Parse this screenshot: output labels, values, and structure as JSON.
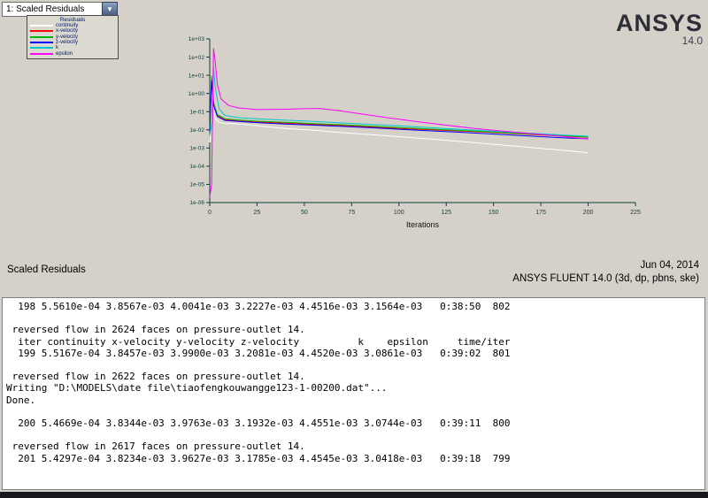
{
  "combo": {
    "value": "1: Scaled Residuals"
  },
  "legend": {
    "title": "Residuals",
    "items": [
      {
        "label": "continuity",
        "color": "#ffffff"
      },
      {
        "label": "x-velocity",
        "color": "#ff0000"
      },
      {
        "label": "y-velocity",
        "color": "#00b400"
      },
      {
        "label": "z-velocity",
        "color": "#0000ff"
      },
      {
        "label": "k",
        "color": "#00c8c8"
      },
      {
        "label": "epsilon",
        "color": "#ff00ff"
      }
    ]
  },
  "logo": {
    "brand": "ANSYS",
    "version": "14.0"
  },
  "caption": {
    "left": "Scaled Residuals",
    "date": "Jun 04, 2014",
    "app": "ANSYS FLUENT 14.0 (3d, dp, pbns, ske)"
  },
  "chart_data": {
    "type": "line",
    "title": "Scaled Residuals",
    "xlabel": "Iterations",
    "x_scale": "linear",
    "y_scale": "log",
    "xlim": [
      0,
      225
    ],
    "ylim_log": [
      -6,
      3
    ],
    "x_ticks": [
      0,
      25,
      50,
      75,
      100,
      125,
      150,
      175,
      200,
      225
    ],
    "y_tick_labels": [
      "1e+03",
      "1e+02",
      "1e+01",
      "1e+00",
      "1e-01",
      "1e-02",
      "1e-03",
      "1e-04",
      "1e-05",
      "1e-06"
    ],
    "axis_color": "#143c3c",
    "grid": false,
    "legend_position": "top-left",
    "series": [
      {
        "name": "continuity",
        "color": "#ffffff",
        "points": [
          [
            0,
            0.002
          ],
          [
            1,
            0.9
          ],
          [
            2,
            0.12
          ],
          [
            3,
            0.04
          ],
          [
            5,
            0.026
          ],
          [
            8,
            0.022
          ],
          [
            12,
            0.022
          ],
          [
            20,
            0.019
          ],
          [
            30,
            0.015
          ],
          [
            40,
            0.012
          ],
          [
            55,
            0.0095
          ],
          [
            70,
            0.007
          ],
          [
            85,
            0.0055
          ],
          [
            100,
            0.0042
          ],
          [
            115,
            0.0032
          ],
          [
            130,
            0.0024
          ],
          [
            145,
            0.0018
          ],
          [
            160,
            0.0013
          ],
          [
            175,
            0.00095
          ],
          [
            190,
            0.0007
          ],
          [
            200,
            0.00055
          ]
        ]
      },
      {
        "name": "x-velocity",
        "color": "#ff0000",
        "points": [
          [
            0,
            0.01
          ],
          [
            1,
            6
          ],
          [
            2,
            0.25
          ],
          [
            4,
            0.06
          ],
          [
            8,
            0.036
          ],
          [
            15,
            0.031
          ],
          [
            25,
            0.027
          ],
          [
            40,
            0.023
          ],
          [
            55,
            0.02
          ],
          [
            70,
            0.017
          ],
          [
            85,
            0.0145
          ],
          [
            100,
            0.012
          ],
          [
            115,
            0.0103
          ],
          [
            130,
            0.0088
          ],
          [
            145,
            0.0075
          ],
          [
            160,
            0.0063
          ],
          [
            175,
            0.0052
          ],
          [
            190,
            0.0044
          ],
          [
            200,
            0.0039
          ]
        ]
      },
      {
        "name": "y-velocity",
        "color": "#00b400",
        "points": [
          [
            0,
            0.012
          ],
          [
            1,
            9
          ],
          [
            2,
            0.32
          ],
          [
            4,
            0.07
          ],
          [
            8,
            0.041
          ],
          [
            15,
            0.035
          ],
          [
            25,
            0.03
          ],
          [
            40,
            0.026
          ],
          [
            55,
            0.022
          ],
          [
            70,
            0.019
          ],
          [
            85,
            0.016
          ],
          [
            100,
            0.0133
          ],
          [
            115,
            0.0112
          ],
          [
            130,
            0.0095
          ],
          [
            145,
            0.008
          ],
          [
            160,
            0.0066
          ],
          [
            175,
            0.0055
          ],
          [
            190,
            0.0046
          ],
          [
            200,
            0.004
          ]
        ]
      },
      {
        "name": "z-velocity",
        "color": "#0000ff",
        "points": [
          [
            0,
            0.008
          ],
          [
            1,
            5
          ],
          [
            2,
            0.22
          ],
          [
            4,
            0.055
          ],
          [
            8,
            0.033
          ],
          [
            15,
            0.029
          ],
          [
            25,
            0.025
          ],
          [
            40,
            0.021
          ],
          [
            55,
            0.018
          ],
          [
            70,
            0.0155
          ],
          [
            85,
            0.013
          ],
          [
            100,
            0.0108
          ],
          [
            115,
            0.009
          ],
          [
            130,
            0.0075
          ],
          [
            145,
            0.0062
          ],
          [
            160,
            0.0051
          ],
          [
            175,
            0.0042
          ],
          [
            190,
            0.0035
          ],
          [
            200,
            0.0032
          ]
        ]
      },
      {
        "name": "k",
        "color": "#00c8c8",
        "points": [
          [
            0,
            0.005
          ],
          [
            1,
            0.02
          ],
          [
            2,
            28
          ],
          [
            3,
            1.8
          ],
          [
            5,
            0.14
          ],
          [
            8,
            0.062
          ],
          [
            15,
            0.047
          ],
          [
            25,
            0.04
          ],
          [
            40,
            0.034
          ],
          [
            55,
            0.029
          ],
          [
            70,
            0.024
          ],
          [
            85,
            0.02
          ],
          [
            100,
            0.0165
          ],
          [
            115,
            0.0135
          ],
          [
            130,
            0.011
          ],
          [
            145,
            0.009
          ],
          [
            160,
            0.0074
          ],
          [
            175,
            0.006
          ],
          [
            190,
            0.005
          ],
          [
            200,
            0.0045
          ]
        ]
      },
      {
        "name": "epsilon",
        "color": "#ff00ff",
        "points": [
          [
            0,
            2e-06
          ],
          [
            1,
            1e-05
          ],
          [
            2,
            300
          ],
          [
            3,
            45
          ],
          [
            4,
            3
          ],
          [
            6,
            0.5
          ],
          [
            10,
            0.22
          ],
          [
            15,
            0.16
          ],
          [
            25,
            0.13
          ],
          [
            40,
            0.135
          ],
          [
            50,
            0.145
          ],
          [
            58,
            0.15
          ],
          [
            68,
            0.115
          ],
          [
            80,
            0.075
          ],
          [
            95,
            0.045
          ],
          [
            110,
            0.028
          ],
          [
            125,
            0.018
          ],
          [
            140,
            0.012
          ],
          [
            155,
            0.0085
          ],
          [
            170,
            0.0062
          ],
          [
            185,
            0.0045
          ],
          [
            200,
            0.0031
          ]
        ]
      }
    ]
  },
  "console": {
    "lines": [
      "  198 5.5610e-04 3.8567e-03 4.0041e-03 3.2227e-03 4.4516e-03 3.1564e-03   0:38:50  802",
      "",
      " reversed flow in 2624 faces on pressure-outlet 14.",
      "  iter continuity x-velocity y-velocity z-velocity          k    epsilon     time/iter",
      "  199 5.5167e-04 3.8457e-03 3.9900e-03 3.2081e-03 4.4520e-03 3.0861e-03   0:39:02  801",
      "",
      " reversed flow in 2622 faces on pressure-outlet 14.",
      "Writing \"D:\\MODELS\\date file\\tiaofengkouwangge123-1-00200.dat\"...",
      "Done.",
      "",
      "  200 5.4669e-04 3.8344e-03 3.9763e-03 3.1932e-03 4.4551e-03 3.0744e-03   0:39:11  800",
      "",
      " reversed flow in 2617 faces on pressure-outlet 14.",
      "  201 5.4297e-04 3.8234e-03 3.9627e-03 3.1785e-03 4.4545e-03 3.0418e-03   0:39:18  799"
    ]
  }
}
